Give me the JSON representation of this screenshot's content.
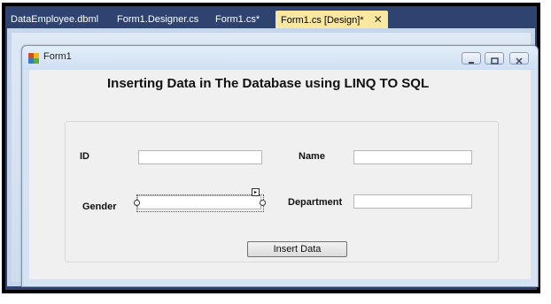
{
  "tabs": [
    {
      "label": "DataEmployee.dbml",
      "active": false
    },
    {
      "label": "Form1.Designer.cs",
      "active": false
    },
    {
      "label": "Form1.cs*",
      "active": false
    },
    {
      "label": "Form1.cs [Design]*",
      "active": true
    }
  ],
  "tab_close_glyph": "✕",
  "form": {
    "title": "Form1",
    "heading": "Inserting Data in The Database using LINQ TO SQL",
    "fields": {
      "id_label": "ID",
      "name_label": "Name",
      "gender_label": "Gender",
      "department_label": "Department",
      "id_value": "",
      "name_value": "",
      "gender_value": "",
      "department_value": ""
    },
    "insert_button": "Insert Data"
  },
  "icons": [
    "form-icon",
    "minimize-icon",
    "restore-icon",
    "close-icon",
    "smart-tag-icon"
  ],
  "colors": {
    "tab_bar": "#2e4370",
    "active_tab": "#fbe8a0",
    "designer_bg": "#c5d6ea",
    "client_bg": "#f0f0f0"
  }
}
